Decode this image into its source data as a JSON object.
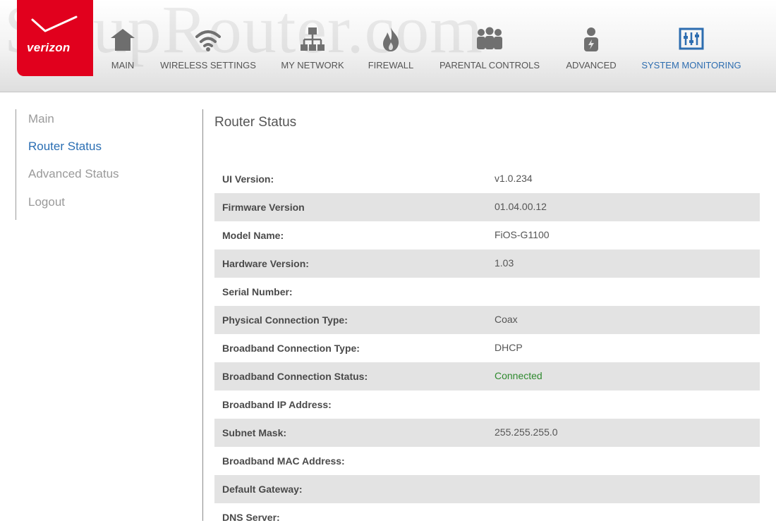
{
  "brand": {
    "watermark": "SetupRouter.com",
    "logo_text": "verizon",
    "logo_color": "#e1001d"
  },
  "nav": {
    "items": [
      {
        "label": "MAIN",
        "icon": "home-icon"
      },
      {
        "label": "WIRELESS SETTINGS",
        "icon": "wifi-icon"
      },
      {
        "label": "MY NETWORK",
        "icon": "network-icon"
      },
      {
        "label": "FIREWALL",
        "icon": "flame-icon"
      },
      {
        "label": "PARENTAL CONTROLS",
        "icon": "family-icon"
      },
      {
        "label": "ADVANCED",
        "icon": "user-settings-icon"
      },
      {
        "label": "SYSTEM MONITORING",
        "icon": "monitor-icon"
      }
    ],
    "active": "SYSTEM MONITORING",
    "active_color": "#2d6db0"
  },
  "sidebar": {
    "items": [
      {
        "label": "Main"
      },
      {
        "label": "Router Status"
      },
      {
        "label": "Advanced Status"
      },
      {
        "label": "Logout"
      }
    ],
    "active": "Router Status"
  },
  "main": {
    "title": "Router Status",
    "rows": [
      {
        "label": "UI Version:",
        "value": "v1.0.234"
      },
      {
        "label": "Firmware Version",
        "value": "01.04.00.12"
      },
      {
        "label": "Model Name:",
        "value": "FiOS-G1100"
      },
      {
        "label": "Hardware Version:",
        "value": "1.03"
      },
      {
        "label": "Serial Number:",
        "value": ""
      },
      {
        "label": "Physical Connection Type:",
        "value": "Coax"
      },
      {
        "label": "Broadband Connection Type:",
        "value": "DHCP"
      },
      {
        "label": "Broadband Connection Status:",
        "value": "Connected"
      },
      {
        "label": "Broadband IP Address:",
        "value": ""
      },
      {
        "label": "Subnet Mask:",
        "value": "255.255.255.0"
      },
      {
        "label": "Broadband MAC Address:",
        "value": ""
      },
      {
        "label": "Default Gateway:",
        "value": ""
      },
      {
        "label": "DNS Server:",
        "value": ""
      }
    ],
    "status_color": "#2f8a2f"
  }
}
